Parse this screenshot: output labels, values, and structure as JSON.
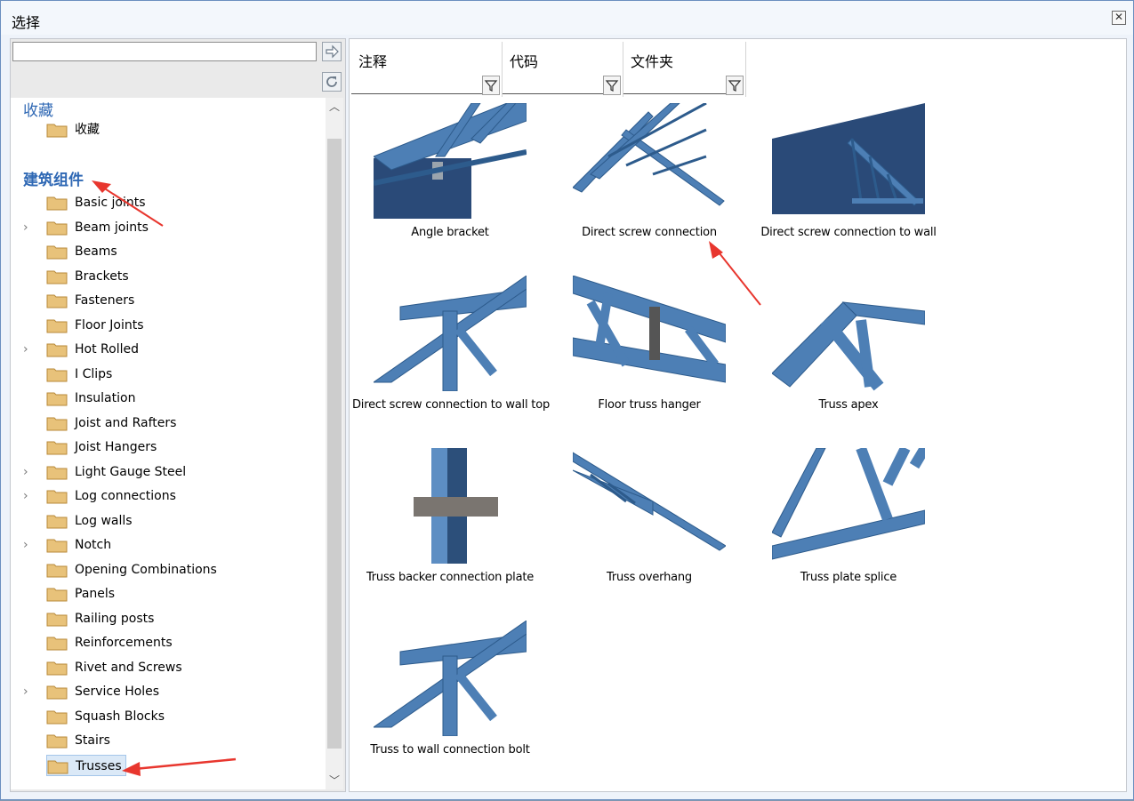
{
  "window": {
    "title": "选择"
  },
  "search": {
    "value": "",
    "placeholder": ""
  },
  "tree": {
    "sections": [
      {
        "label": "收藏",
        "items": [
          {
            "label": "收藏"
          }
        ]
      },
      {
        "label": "建筑组件"
      }
    ],
    "items": [
      {
        "label": "Basic joints",
        "expandable": false
      },
      {
        "label": "Beam joints",
        "expandable": true
      },
      {
        "label": "Beams",
        "expandable": false
      },
      {
        "label": "Brackets",
        "expandable": false
      },
      {
        "label": "Fasteners",
        "expandable": false
      },
      {
        "label": "Floor Joints",
        "expandable": false
      },
      {
        "label": "Hot Rolled",
        "expandable": true
      },
      {
        "label": "I Clips",
        "expandable": false
      },
      {
        "label": "Insulation",
        "expandable": false
      },
      {
        "label": "Joist and Rafters",
        "expandable": false
      },
      {
        "label": "Joist Hangers",
        "expandable": false
      },
      {
        "label": "Light Gauge Steel",
        "expandable": true
      },
      {
        "label": "Log connections",
        "expandable": true
      },
      {
        "label": "Log walls",
        "expandable": false
      },
      {
        "label": "Notch",
        "expandable": true
      },
      {
        "label": "Opening Combinations",
        "expandable": false
      },
      {
        "label": "Panels",
        "expandable": false
      },
      {
        "label": "Railing posts",
        "expandable": false
      },
      {
        "label": "Reinforcements",
        "expandable": false
      },
      {
        "label": "Rivet and Screws",
        "expandable": false
      },
      {
        "label": "Service Holes",
        "expandable": true
      },
      {
        "label": "Squash Blocks",
        "expandable": false
      },
      {
        "label": "Stairs",
        "expandable": false
      },
      {
        "label": "Trusses",
        "expandable": false,
        "selected": true
      }
    ]
  },
  "columns": [
    {
      "label": "注释"
    },
    {
      "label": "代码"
    },
    {
      "label": "文件夹"
    }
  ],
  "thumbnails": [
    {
      "caption": "Angle bracket",
      "icon": "angle-bracket-icon"
    },
    {
      "caption": "Direct screw connection",
      "icon": "direct-screw-connection-icon"
    },
    {
      "caption": "Direct screw connection to wall",
      "icon": "direct-screw-connection-to-wall-icon"
    },
    {
      "caption": "Direct screw connection to wall top",
      "icon": "direct-screw-connection-to-wall-top-icon"
    },
    {
      "caption": "Floor truss hanger",
      "icon": "floor-truss-hanger-icon"
    },
    {
      "caption": "Truss apex",
      "icon": "truss-apex-icon"
    },
    {
      "caption": "Truss backer connection plate",
      "icon": "truss-backer-connection-plate-icon"
    },
    {
      "caption": "Truss overhang",
      "icon": "truss-overhang-icon"
    },
    {
      "caption": "Truss plate splice",
      "icon": "truss-plate-splice-icon"
    },
    {
      "caption": "Truss to wall connection bolt",
      "icon": "truss-to-wall-connection-bolt-icon"
    }
  ],
  "colors": {
    "accent": "#2f68b4",
    "steel": "#4d7fb5",
    "steel_dark": "#2d5b8c",
    "folder": "#e8c27a",
    "annotation": "#e8362e"
  }
}
